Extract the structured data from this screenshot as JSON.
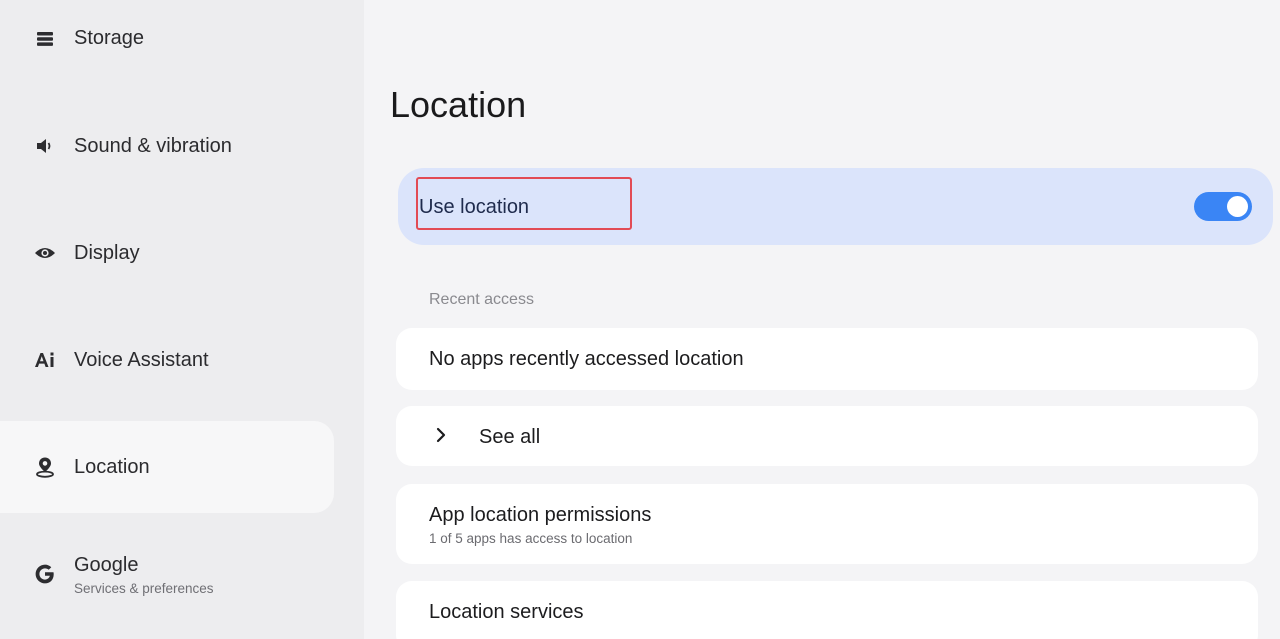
{
  "sidebar": {
    "items": [
      {
        "label": "Storage",
        "icon": "storage-icon"
      },
      {
        "label": "Sound & vibration",
        "icon": "speaker-icon"
      },
      {
        "label": "Display",
        "icon": "eye-icon"
      },
      {
        "label": "Voice Assistant",
        "icon": "ai-icon"
      },
      {
        "label": "Location",
        "icon": "location-pin-icon",
        "active": true
      },
      {
        "label": "Google",
        "sublabel": "Services & preferences",
        "icon": "google-icon"
      }
    ]
  },
  "main": {
    "title": "Location",
    "use_location": {
      "label": "Use location",
      "enabled": true
    },
    "recent_access_header": "Recent access",
    "recent_access_empty": "No apps recently accessed location",
    "see_all": "See all",
    "app_permissions": {
      "title": "App location permissions",
      "subtitle": "1 of 5 apps has access to location"
    },
    "location_services": "Location services"
  },
  "colors": {
    "accent": "#3a85f5",
    "use_location_bg": "#dbe4fb",
    "highlight": "#e24b55"
  }
}
